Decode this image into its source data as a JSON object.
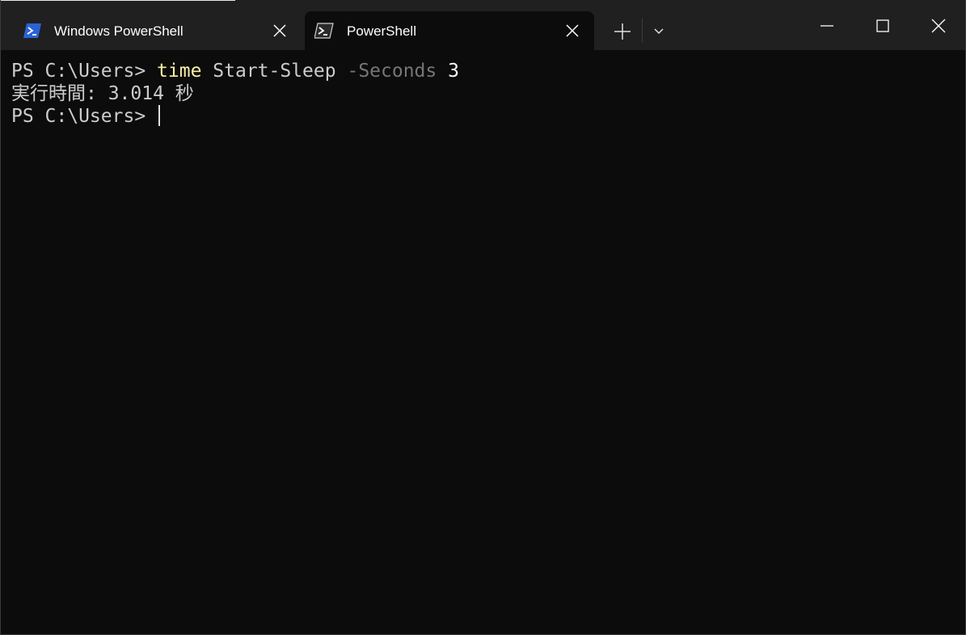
{
  "window": {
    "tabs": [
      {
        "label": "Windows PowerShell",
        "icon": "windows-powershell-icon",
        "active": false,
        "icon_color": "#2b63d6"
      },
      {
        "label": "PowerShell",
        "icon": "powershell-icon",
        "active": true,
        "icon_color": "#3a3a3a"
      }
    ],
    "new_tab_icon": "plus-icon",
    "dropdown_icon": "chevron-down-icon",
    "controls": [
      "minimize-icon",
      "maximize-icon",
      "close-icon"
    ]
  },
  "terminal": {
    "line1": {
      "prompt": "PS C:\\Users>",
      "command": "time",
      "arg": "Start-Sleep",
      "param": "-Seconds",
      "value": "3"
    },
    "line2": {
      "text": "実行時間: 3.014 秒"
    },
    "line3": {
      "prompt": "PS C:\\Users>"
    }
  },
  "colors": {
    "background": "#0c0c0c",
    "titlebar": "#202020",
    "text": "#cccccc",
    "command": "#f9f1a5",
    "parameter": "#767676"
  }
}
